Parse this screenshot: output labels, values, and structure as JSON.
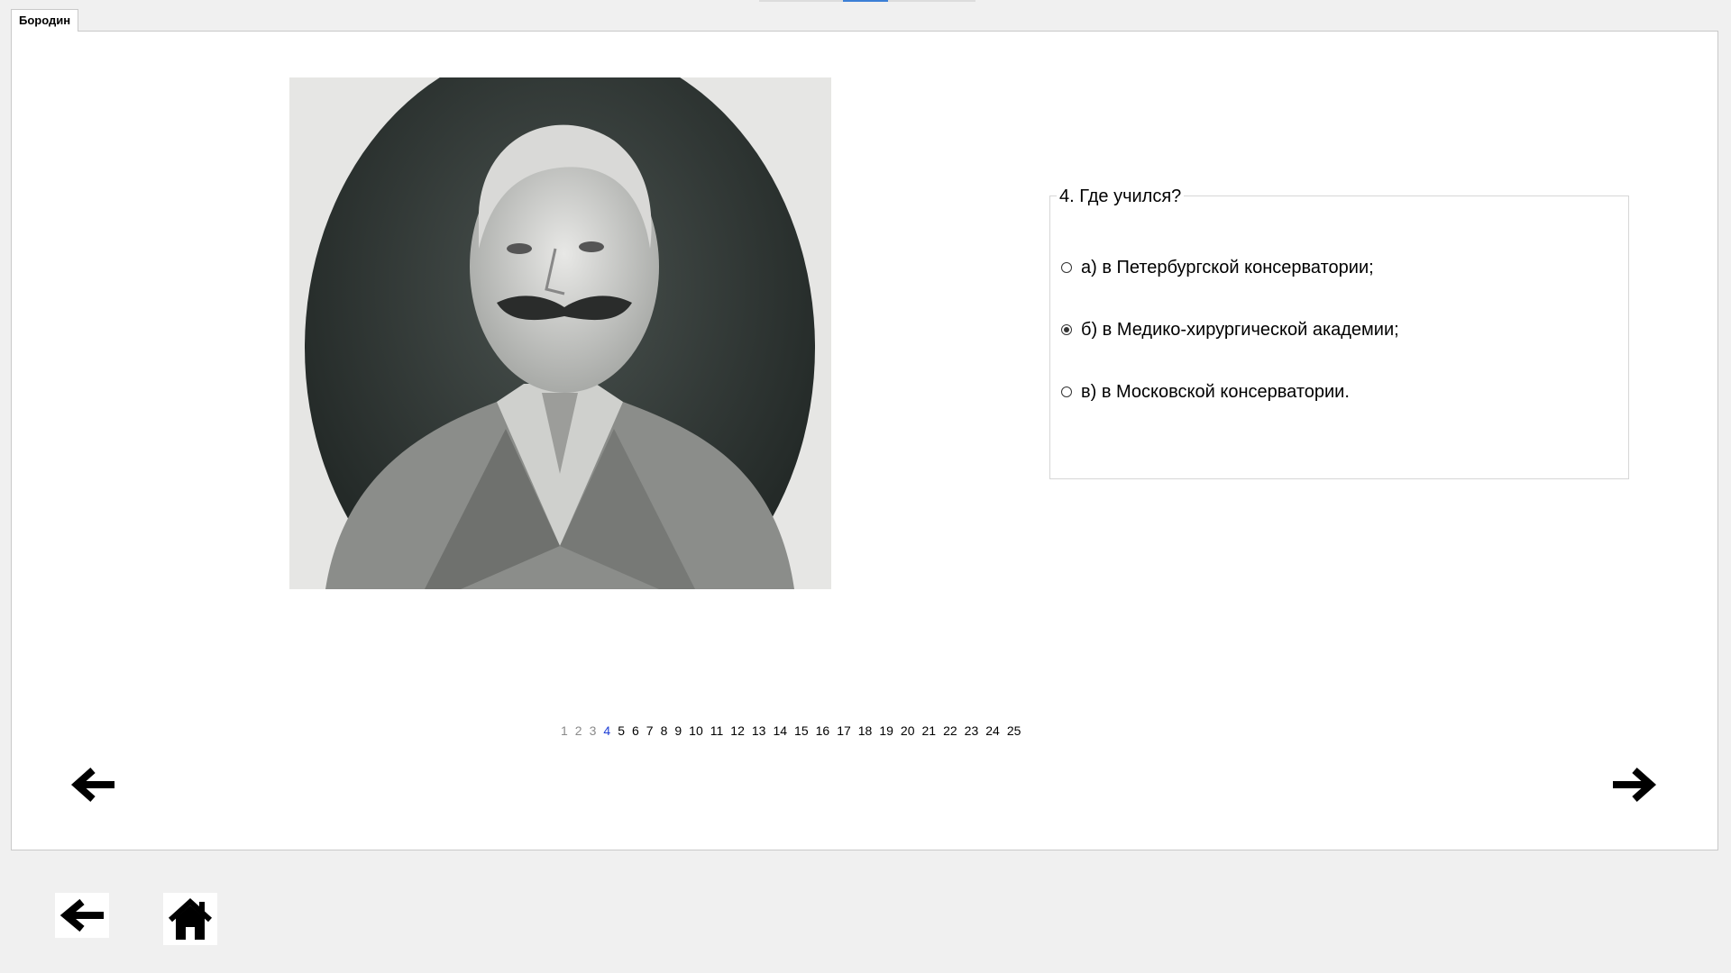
{
  "tab": {
    "label": "Бородин"
  },
  "question": {
    "title": "4. Где учился?",
    "options": [
      {
        "label": "а) в Петербургской консерватории;",
        "selected": false
      },
      {
        "label": "б) в Медико-хирургической академии;",
        "selected": true
      },
      {
        "label": "в) в Московской консерватории.",
        "selected": false
      }
    ]
  },
  "pager": {
    "pages": [
      "1",
      "2",
      "3",
      "4",
      "5",
      "6",
      "7",
      "8",
      "9",
      "10",
      "11",
      "12",
      "13",
      "14",
      "15",
      "16",
      "17",
      "18",
      "19",
      "20",
      "21",
      "22",
      "23",
      "24",
      "25"
    ],
    "current": "4",
    "visited": [
      "1",
      "2",
      "3"
    ]
  },
  "icons": {
    "prev": "arrow-left-icon",
    "next": "arrow-right-icon",
    "back": "arrow-left-icon",
    "home": "home-icon"
  },
  "colors": {
    "current_page": "#1f3fd6",
    "visited_page": "#8a8a8a",
    "background": "#f0f0f0"
  }
}
